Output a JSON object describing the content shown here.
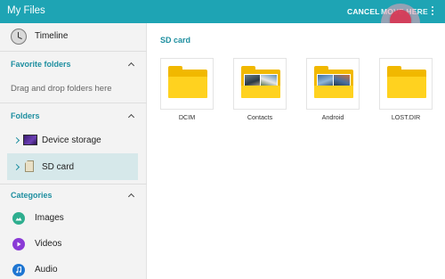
{
  "appbar": {
    "title": "My Files",
    "cancel_label": "CANCEL",
    "move_here_label": "MOVE HERE",
    "accent_color": "#1ea4b4"
  },
  "sidebar": {
    "timeline_label": "Timeline",
    "favorites": {
      "title": "Favorite folders",
      "hint": "Drag and drop folders here"
    },
    "folders": {
      "title": "Folders",
      "items": [
        {
          "label": "Device storage",
          "icon": "device-storage-icon",
          "selected": false
        },
        {
          "label": "SD card",
          "icon": "sd-card-icon",
          "selected": true
        }
      ]
    },
    "categories": {
      "title": "Categories",
      "items": [
        {
          "label": "Images",
          "icon": "images-icon",
          "color": "#2eae8f"
        },
        {
          "label": "Videos",
          "icon": "videos-icon",
          "color": "#8a3ad6"
        },
        {
          "label": "Audio",
          "icon": "audio-icon",
          "color": "#1f76d2"
        }
      ]
    }
  },
  "main": {
    "breadcrumb": "SD card",
    "folders": [
      {
        "name": "DCIM",
        "has_preview": false
      },
      {
        "name": "Contacts",
        "has_preview": true
      },
      {
        "name": "Android",
        "has_preview": true
      },
      {
        "name": "LOST.DIR",
        "has_preview": false
      }
    ]
  }
}
